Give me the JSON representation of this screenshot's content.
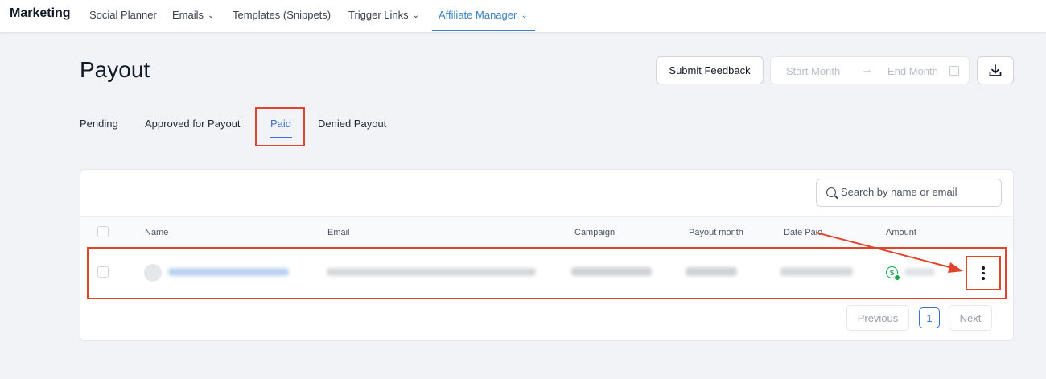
{
  "topnav": {
    "brand": "Marketing",
    "items": [
      {
        "label": "Social Planner",
        "has_chevron": false,
        "active": false
      },
      {
        "label": "Emails",
        "has_chevron": true,
        "active": false
      },
      {
        "label": "Templates (Snippets)",
        "has_chevron": false,
        "active": false
      },
      {
        "label": "Trigger Links",
        "has_chevron": true,
        "active": false
      },
      {
        "label": "Affiliate Manager",
        "has_chevron": true,
        "active": true
      }
    ],
    "chevron": "⌄"
  },
  "header": {
    "title": "Payout",
    "feedback_label": "Submit Feedback",
    "start_month_placeholder": "Start Month",
    "end_month_placeholder": "End Month",
    "arrow_glyph": "→",
    "download_icon": "download-icon"
  },
  "tabs": [
    {
      "label": "Pending",
      "active": false
    },
    {
      "label": "Approved for Payout",
      "active": false
    },
    {
      "label": "Paid",
      "active": true
    },
    {
      "label": "Denied Payout",
      "active": false
    }
  ],
  "search": {
    "placeholder": "Search by name or email"
  },
  "table": {
    "columns": [
      "Name",
      "Email",
      "Campaign",
      "Payout month",
      "Date Paid",
      "Amount"
    ],
    "rows": [
      {
        "name": "",
        "email": "",
        "campaign": "",
        "payout_month": "",
        "date_paid": "",
        "amount": "",
        "amount_icon": "dollar-paid-icon"
      }
    ]
  },
  "pagination": {
    "previous": "Previous",
    "current_page": "1",
    "next": "Next"
  },
  "colors": {
    "accent": "#3b82c4",
    "tab_active": "#3b6fd4",
    "annotation": "#e0442b",
    "paid_green": "#16a34a"
  }
}
